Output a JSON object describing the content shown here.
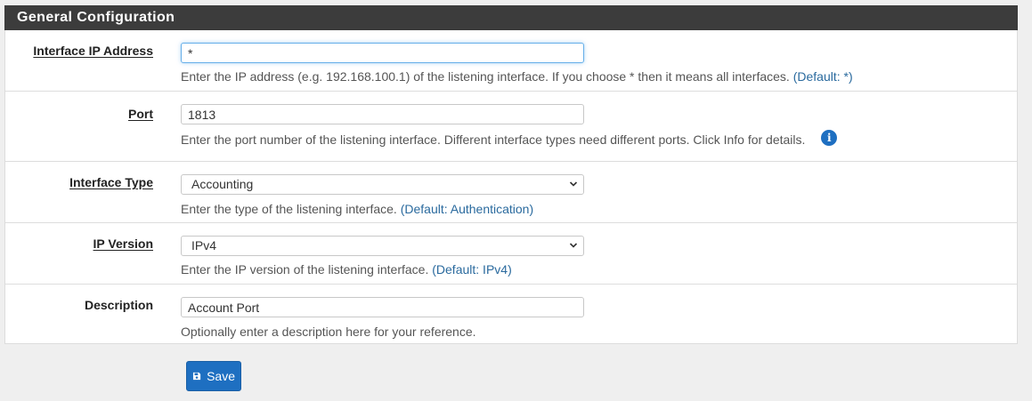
{
  "panel": {
    "title": "General Configuration"
  },
  "fields": {
    "ip_address": {
      "label": "Interface IP Address",
      "value": "*",
      "help": "Enter the IP address (e.g. 192.168.100.1) of the listening interface. If you choose * then it means all interfaces.",
      "default": "(Default: *)"
    },
    "port": {
      "label": "Port",
      "value": "1813",
      "help": "Enter the port number of the listening interface. Different interface types need different ports. Click Info for details.",
      "info_icon": "info-circle-icon"
    },
    "interface_type": {
      "label": "Interface Type",
      "value": "Accounting",
      "help": "Enter the type of the listening interface.",
      "default": "(Default: Authentication)"
    },
    "ip_version": {
      "label": "IP Version",
      "value": "IPv4",
      "help": "Enter the IP version of the listening interface.",
      "default": "(Default: IPv4)"
    },
    "description": {
      "label": "Description",
      "value": "Account Port",
      "help": "Optionally enter a description here for your reference."
    }
  },
  "actions": {
    "save_label": "Save",
    "save_icon": "floppy-disk-icon"
  },
  "colors": {
    "header_bg": "#3c3c3c",
    "primary": "#1e6fc1",
    "link": "#2a6a9e"
  }
}
